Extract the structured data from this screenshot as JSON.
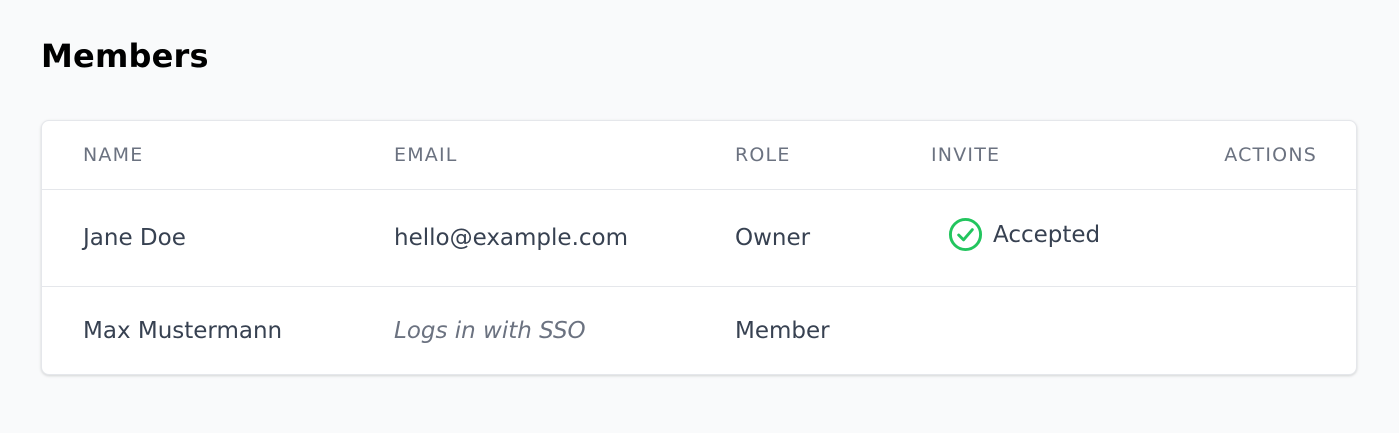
{
  "page": {
    "title": "Members"
  },
  "table": {
    "headers": {
      "name": "Name",
      "email": "Email",
      "role": "Role",
      "invite": "Invite",
      "actions": "Actions"
    },
    "rows": [
      {
        "name": "Jane Doe",
        "email": "hello@example.com",
        "role": "Owner",
        "invite": "Accepted",
        "invite_icon": "check-circle-icon"
      },
      {
        "name": "Max Mustermann",
        "email": "Logs in with SSO",
        "role": "Member",
        "invite": ""
      }
    ]
  },
  "colors": {
    "accepted": "#22c55e",
    "header_text": "#6b7280",
    "body_text": "#374151"
  }
}
